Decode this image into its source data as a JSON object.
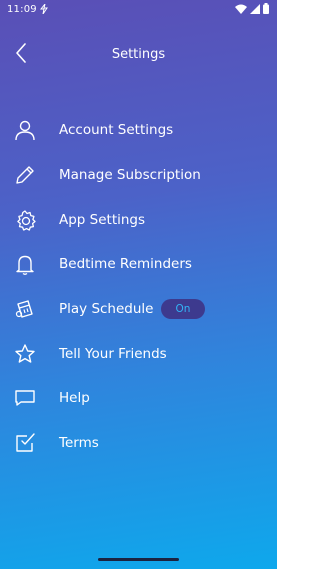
{
  "status_bar": {
    "time": "11:09",
    "icons": [
      "dnd-icon",
      "wifi-icon",
      "signal-icon",
      "battery-icon"
    ]
  },
  "header": {
    "title": "Settings",
    "back_icon": "chevron-left-icon"
  },
  "menu": {
    "items": [
      {
        "label": "Account Settings",
        "icon": "person-icon"
      },
      {
        "label": "Manage Subscription",
        "icon": "pencil-icon"
      },
      {
        "label": "App Settings",
        "icon": "gear-icon"
      },
      {
        "label": "Bedtime Reminders",
        "icon": "bell-icon"
      },
      {
        "label": "Play Schedule",
        "icon": "calendar-icon",
        "toggle": "On"
      },
      {
        "label": "Tell Your Friends",
        "icon": "star-icon"
      },
      {
        "label": "Help",
        "icon": "chat-bubble-icon"
      },
      {
        "label": "Terms",
        "icon": "checkbox-icon"
      }
    ]
  },
  "colors": {
    "gradient_top": "#5a4fb6",
    "gradient_bottom": "#0ea8ec",
    "toggle_bg": "#3d3a8e",
    "toggle_text": "#33b3f5"
  }
}
